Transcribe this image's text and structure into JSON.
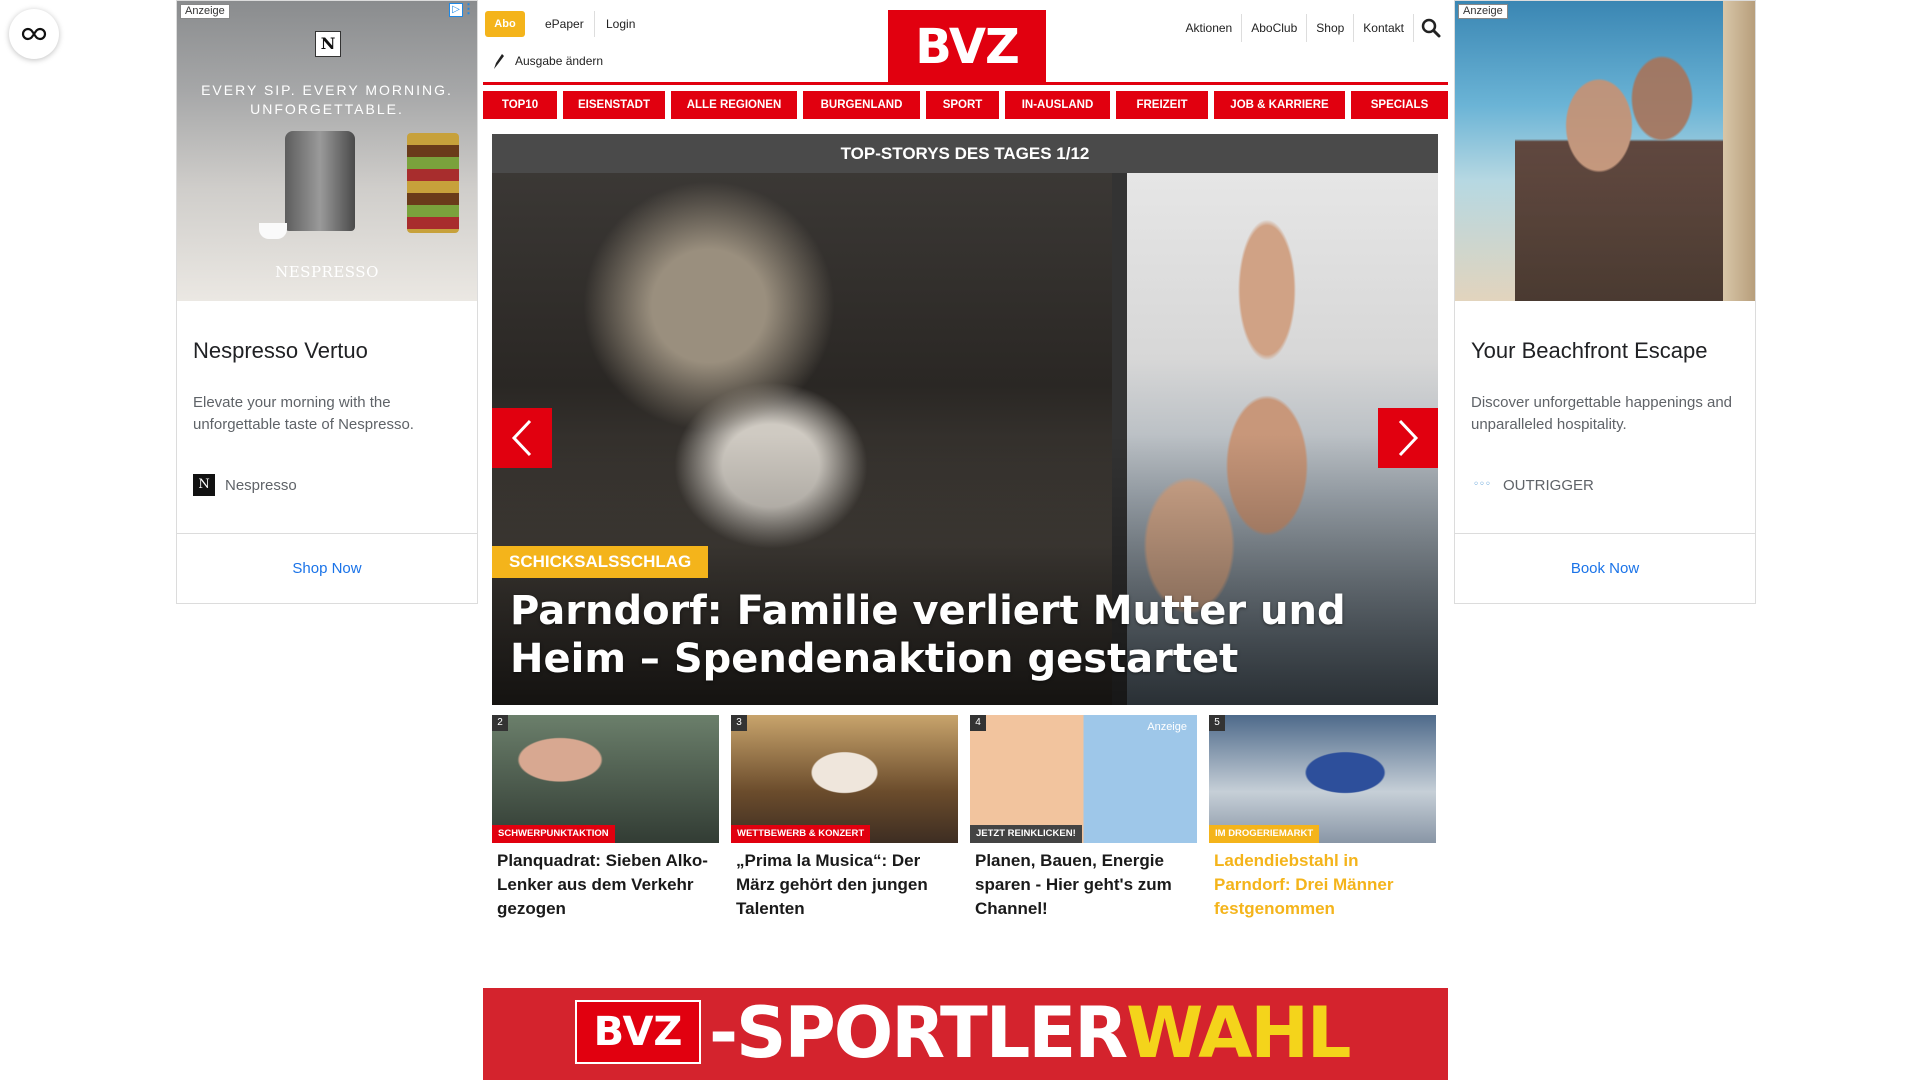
{
  "ads": {
    "left": {
      "tag": "Anzeige",
      "choice": "▷",
      "logo_letter": "N",
      "slogan": "EVERY SIP. EVERY MORNING. UNFORGETTABLE.",
      "brand_mark": "NESPRESSO",
      "title": "Nespresso Vertuo",
      "description": "Elevate your morning with the unforgettable taste of Nespresso.",
      "advertiser": "Nespresso",
      "cta": "Shop Now"
    },
    "right": {
      "tag": "Anzeige",
      "choice": "▷",
      "title": "Your Beachfront Escape",
      "description": "Discover unforgettable happenings and unparalleled hospitality.",
      "advertiser_logo": "◦◦◦",
      "advertiser": "OUTRIGGER",
      "cta": "Book Now"
    }
  },
  "header": {
    "abo": "Abo",
    "epaper": "ePaper",
    "login": "Login",
    "ausgabe": "Ausgabe ändern",
    "logo": "BVZ",
    "right_links": [
      "Aktionen",
      "AboClub",
      "Shop",
      "Kontakt"
    ]
  },
  "nav": [
    "TOP10",
    "EISENSTADT",
    "ALLE REGIONEN",
    "BURGENLAND",
    "SPORT",
    "IN-AUSLAND",
    "FREIZEIT",
    "JOB & KARRIERE",
    "SPECIALS"
  ],
  "top_story": {
    "heading": "TOP-STORYS DES TAGES 1/12",
    "kicker": "SCHICKSALSSCHLAG",
    "headline": "Parndorf: Familie verliert Mutter und Heim – Spendenaktion gestartet"
  },
  "teasers": [
    {
      "num": "2",
      "badge": "SCHWERPUNKTAKTION",
      "title": "Planquadrat: Sieben Alko-Lenker aus dem Verkehr gezogen"
    },
    {
      "num": "3",
      "badge": "WETTBEWERB & KONZERT",
      "title": "„Prima la Musica“: Der März gehört den jungen Talenten"
    },
    {
      "num": "4",
      "badge": "JETZT REINKLICKEN!",
      "ad_label": "Anzeige",
      "title": "Planen, Bauen, Energie sparen - Hier geht's zum Channel!"
    },
    {
      "num": "5",
      "badge": "IM DROGERIEMARKT",
      "title": "Ladendiebstahl in Parndorf: Drei Männer festgenommen"
    }
  ],
  "banner": {
    "logo": "BVZ",
    "text_a": "-SPORTLER",
    "text_b": "WAHL"
  },
  "colors": {
    "brand_red": "#e1000f",
    "accent_gold": "#f4b41b",
    "ad_link_blue": "#1a73e8"
  }
}
